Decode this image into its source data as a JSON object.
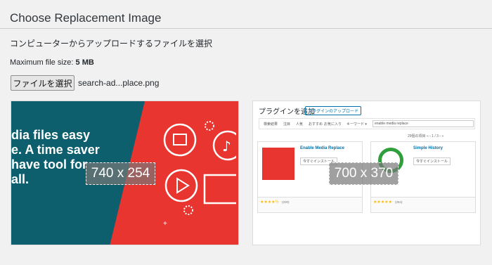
{
  "page": {
    "title": "Choose Replacement Image",
    "instruction": "コンピューターからアップロードするファイルを選択",
    "max_file_size_label": "Maximum file size:",
    "max_file_size_value": "5 MB"
  },
  "file_input": {
    "button_label": "ファイルを選択",
    "selected_filename": "search-ad...place.png"
  },
  "previews": [
    {
      "dimensions": "740 x 254",
      "promo_lines": [
        "dia files easy",
        "e. A time saver",
        "have tool for",
        "all."
      ]
    },
    {
      "dimensions": "700 x 370",
      "header": "プラグインを追加",
      "upload_button": "プラグインのアップロード",
      "tabs": [
        "検索結果",
        "注目",
        "人気",
        "おすすめ",
        "お気に入り"
      ],
      "keyword_select": "キーワード ▾",
      "search_value": "enable media replace",
      "pager": "29個の項目  «  ‹  1  / 3 ›  »",
      "cards": [
        {
          "title": "Enable Media Replace",
          "button": "今すぐインストール",
          "stars": "★★★★½",
          "rating_count": "(200)"
        },
        {
          "title": "Simple History",
          "button": "今すぐインストール",
          "stars": "★★★★★",
          "rating_count": "(254)"
        }
      ]
    }
  ],
  "colors": {
    "teal": "#0e5f6d",
    "red": "#e93530",
    "link": "#0073aa"
  }
}
